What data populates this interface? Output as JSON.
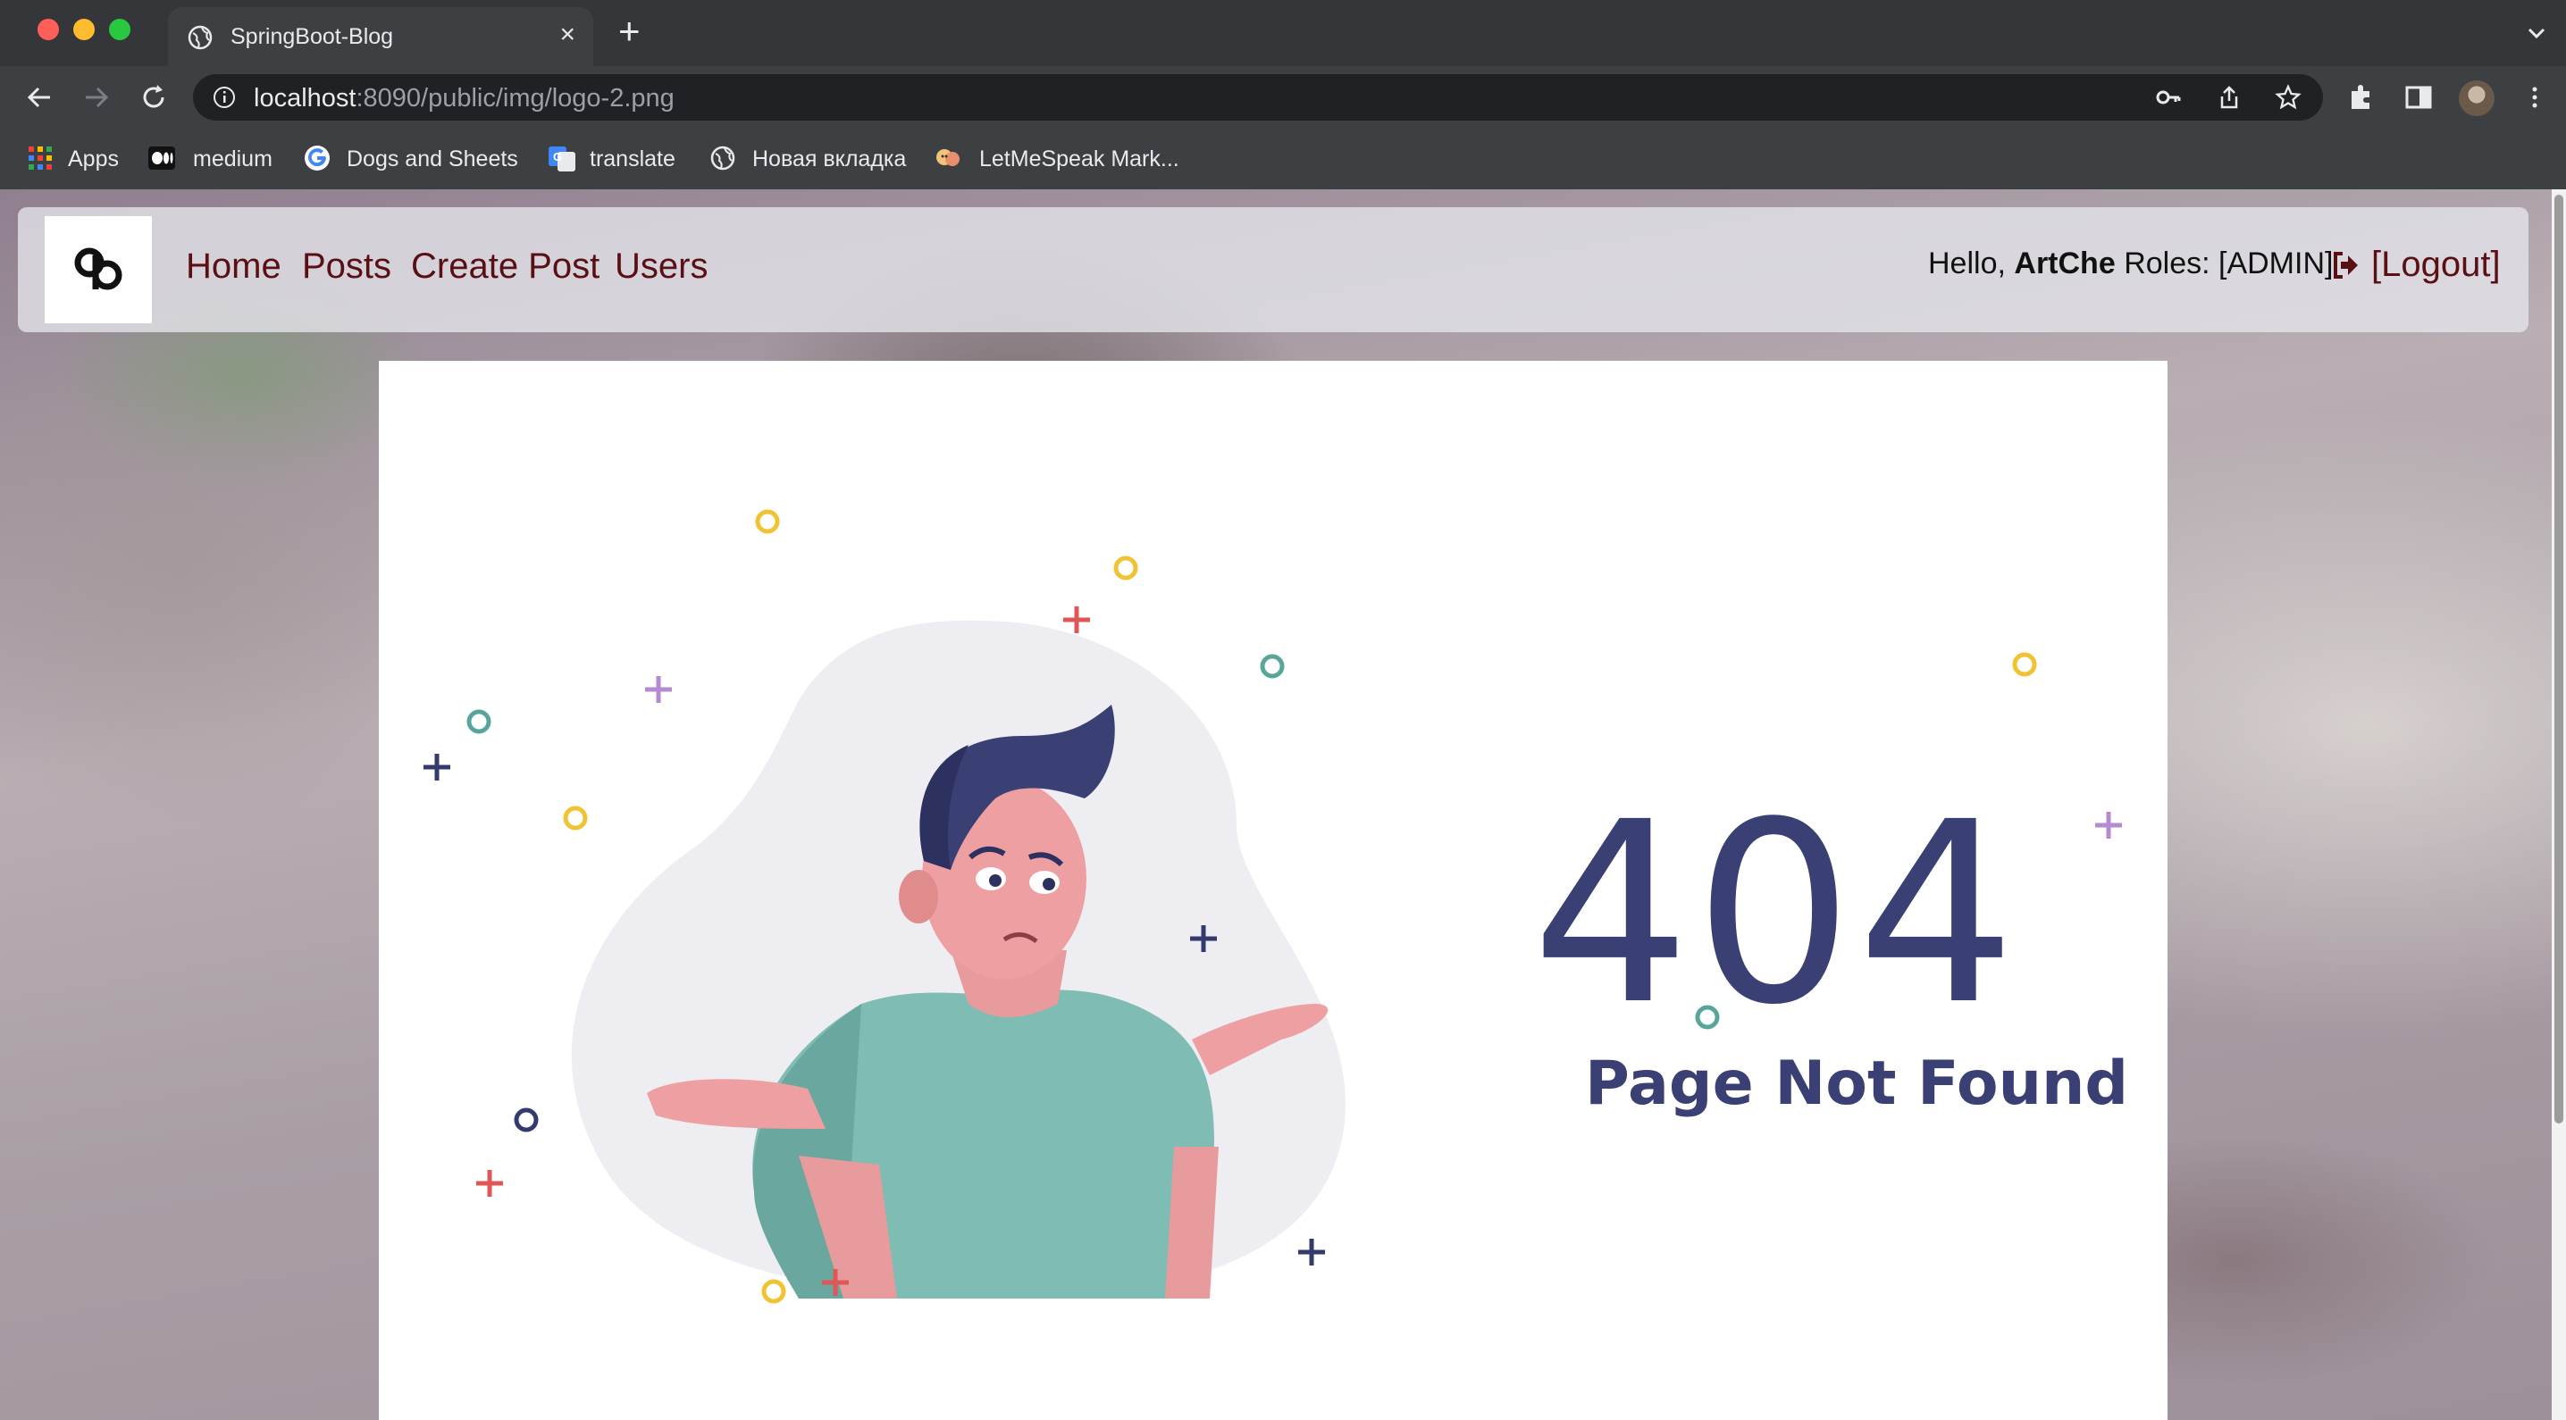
{
  "browser": {
    "tab": {
      "title": "SpringBoot-Blog",
      "close_glyph": "×"
    },
    "new_tab_glyph": "+",
    "url": {
      "host": "localhost",
      "rest": ":8090/public/img/logo-2.png"
    },
    "bookmarks": [
      {
        "label": "Apps",
        "icon": "apps-grid-icon"
      },
      {
        "label": "medium",
        "icon": "medium-icon"
      },
      {
        "label": "Dogs and Sheets",
        "icon": "google-icon"
      },
      {
        "label": "translate",
        "icon": "google-translate-icon"
      },
      {
        "label": "Новая вкладка",
        "icon": "globe-icon"
      },
      {
        "label": "LetMeSpeak Mark...",
        "icon": "letmespeak-icon"
      }
    ]
  },
  "navbar": {
    "links": [
      "Home",
      "Posts",
      "Create Post",
      "Users"
    ],
    "greeting_prefix": "Hello,",
    "username": "ArtChe",
    "roles": "Roles: [ADMIN]",
    "logout": "[Logout]"
  },
  "error": {
    "code": "404",
    "message": "Page Not Found"
  },
  "colors": {
    "nav_link": "#5a0f14",
    "error_text": "#3a3f74",
    "accent_yellow": "#f1c232",
    "accent_red": "#e05656",
    "accent_purple": "#b58ad0",
    "accent_teal": "#5aa59a",
    "accent_navy": "#333a6e"
  }
}
